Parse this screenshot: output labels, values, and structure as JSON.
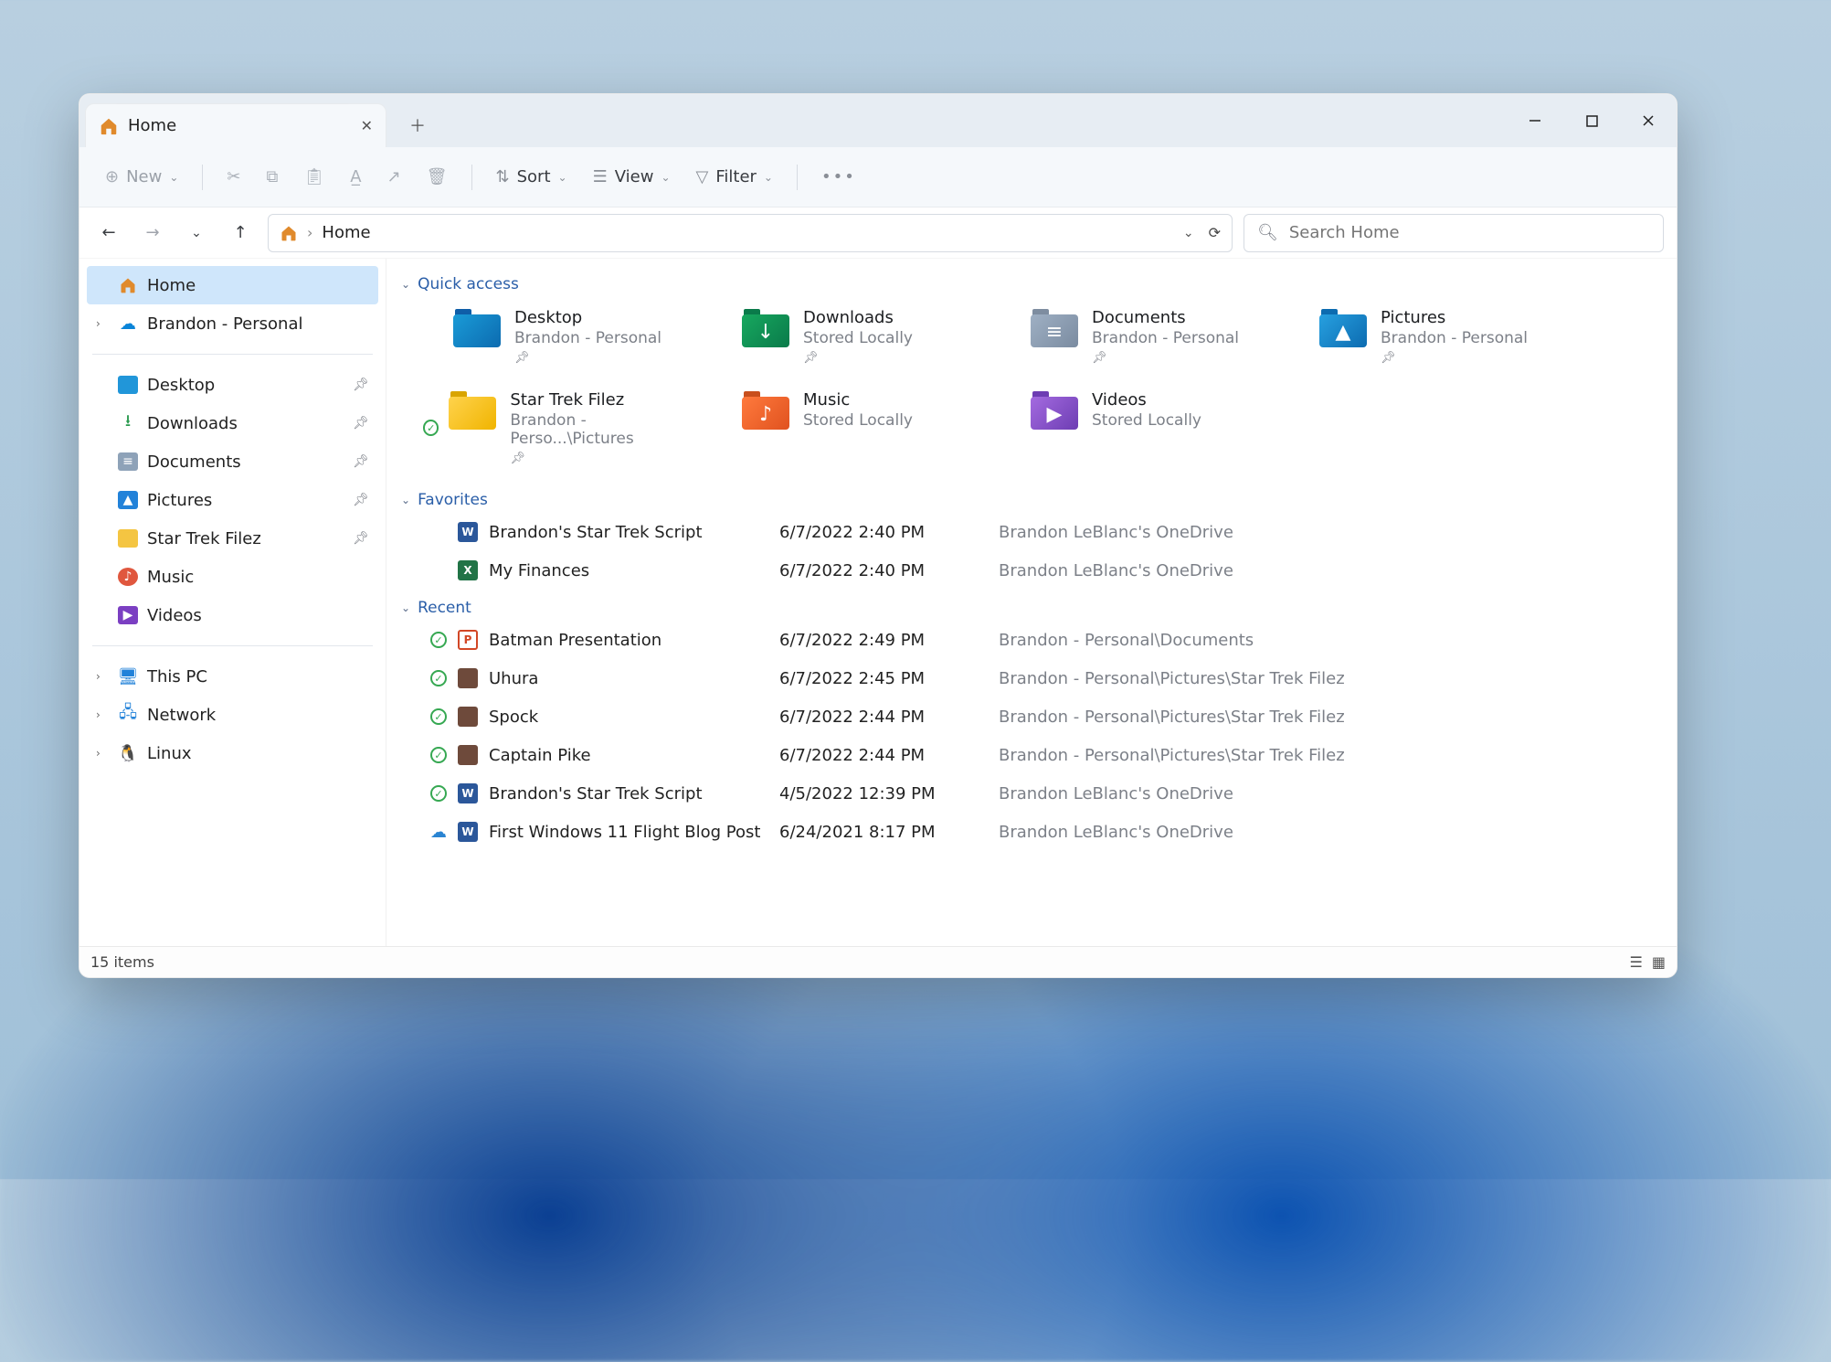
{
  "titlebar": {
    "tab_label": "Home"
  },
  "toolbar": {
    "new_label": "New",
    "sort_label": "Sort",
    "view_label": "View",
    "filter_label": "Filter"
  },
  "address": {
    "path_label": "Home"
  },
  "search": {
    "placeholder": "Search Home"
  },
  "sidebar": {
    "top": [
      {
        "label": "Home",
        "icon": "home"
      },
      {
        "label": "Brandon - Personal",
        "icon": "cloud",
        "expandable": true
      }
    ],
    "pinned": [
      {
        "label": "Desktop",
        "icon": "desktop",
        "pinned": true
      },
      {
        "label": "Downloads",
        "icon": "dl",
        "pinned": true
      },
      {
        "label": "Documents",
        "icon": "docs",
        "pinned": true
      },
      {
        "label": "Pictures",
        "icon": "pics",
        "pinned": true
      },
      {
        "label": "Star Trek Filez",
        "icon": "st",
        "pinned": true
      },
      {
        "label": "Music",
        "icon": "music",
        "pinned": false
      },
      {
        "label": "Videos",
        "icon": "vids",
        "pinned": false
      }
    ],
    "bottom": [
      {
        "label": "This PC",
        "icon": "pc",
        "expandable": true
      },
      {
        "label": "Network",
        "icon": "net",
        "expandable": true
      },
      {
        "label": "Linux",
        "icon": "tux",
        "expandable": true
      }
    ]
  },
  "sections": {
    "quick_access_title": "Quick access",
    "favorites_title": "Favorites",
    "recent_title": "Recent"
  },
  "quick_access": [
    {
      "name": "Desktop",
      "sub": "Brandon - Personal",
      "pin": true,
      "color": "blue",
      "glyph": ""
    },
    {
      "name": "Downloads",
      "sub": "Stored Locally",
      "pin": true,
      "color": "green",
      "glyph": "↓"
    },
    {
      "name": "Documents",
      "sub": "Brandon - Personal",
      "pin": true,
      "color": "grey",
      "glyph": "≡"
    },
    {
      "name": "Pictures",
      "sub": "Brandon - Personal",
      "pin": true,
      "color": "cyan",
      "glyph": "▲"
    },
    {
      "name": "Star Trek Filez",
      "sub": "Brandon - Perso...\\Pictures",
      "pin": true,
      "color": "yellow",
      "glyph": "",
      "synced": true
    },
    {
      "name": "Music",
      "sub": "Stored Locally",
      "pin": false,
      "color": "orange",
      "glyph": "♪"
    },
    {
      "name": "Videos",
      "sub": "Stored Locally",
      "pin": false,
      "color": "purple",
      "glyph": "▶"
    }
  ],
  "favorites": [
    {
      "name": "Brandon's Star Trek Script",
      "date": "6/7/2022 2:40 PM",
      "loc": "Brandon LeBlanc's OneDrive",
      "ico": "word"
    },
    {
      "name": "My Finances",
      "date": "6/7/2022 2:40 PM",
      "loc": "Brandon LeBlanc's OneDrive",
      "ico": "xls"
    }
  ],
  "recent": [
    {
      "name": "Batman Presentation",
      "date": "6/7/2022 2:49 PM",
      "loc": "Brandon - Personal\\Documents",
      "ico": "ppt",
      "sync": "check"
    },
    {
      "name": "Uhura",
      "date": "6/7/2022 2:45 PM",
      "loc": "Brandon - Personal\\Pictures\\Star Trek Filez",
      "ico": "img",
      "sync": "check"
    },
    {
      "name": "Spock",
      "date": "6/7/2022 2:44 PM",
      "loc": "Brandon - Personal\\Pictures\\Star Trek Filez",
      "ico": "img",
      "sync": "check"
    },
    {
      "name": "Captain Pike",
      "date": "6/7/2022 2:44 PM",
      "loc": "Brandon - Personal\\Pictures\\Star Trek Filez",
      "ico": "img",
      "sync": "check"
    },
    {
      "name": "Brandon's Star Trek Script",
      "date": "4/5/2022 12:39 PM",
      "loc": "Brandon LeBlanc's OneDrive",
      "ico": "word",
      "sync": "check"
    },
    {
      "name": "First Windows 11 Flight Blog Post",
      "date": "6/24/2021 8:17 PM",
      "loc": "Brandon LeBlanc's OneDrive",
      "ico": "word",
      "sync": "cloud"
    }
  ],
  "status": {
    "count_label": "15 items"
  }
}
